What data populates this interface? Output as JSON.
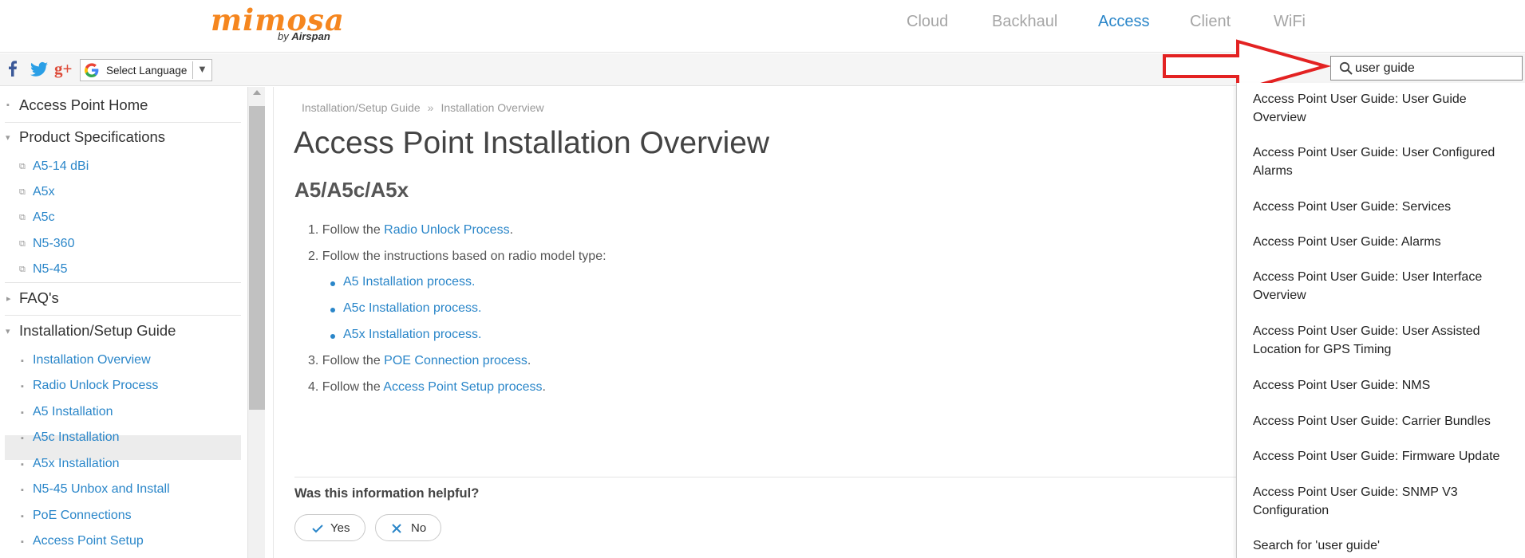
{
  "brand": {
    "name": "mimosa",
    "byline_prefix": "by",
    "byline_company": "Airspan",
    "accent": "#f5861f"
  },
  "topnav": {
    "items": [
      {
        "label": "Cloud",
        "active": false
      },
      {
        "label": "Backhaul",
        "active": false
      },
      {
        "label": "Access",
        "active": true
      },
      {
        "label": "Client",
        "active": false
      },
      {
        "label": "WiFi",
        "active": false
      }
    ],
    "active_color": "#2a86c9"
  },
  "toolbar": {
    "social_icons": [
      "facebook-icon",
      "twitter-icon",
      "google-plus-icon"
    ],
    "language": {
      "label": "Select Language",
      "icon": "google-icon",
      "arrow": "▼"
    }
  },
  "search": {
    "value": "user guide",
    "icon": "search-icon"
  },
  "sidebar": {
    "sections": [
      {
        "label": "Access Point Home",
        "icon": "page-icon"
      },
      {
        "label": "Product Specifications",
        "icon": "expanded-triangle-icon",
        "items": [
          {
            "label": "A5-14 dBi",
            "icon": "external-link-icon"
          },
          {
            "label": "A5x",
            "icon": "external-link-icon"
          },
          {
            "label": "A5c",
            "icon": "external-link-icon"
          },
          {
            "label": "N5-360",
            "icon": "external-link-icon"
          },
          {
            "label": "N5-45",
            "icon": "external-link-icon"
          }
        ]
      },
      {
        "label": "FAQ's",
        "icon": "collapsed-triangle-icon"
      },
      {
        "label": "Installation/Setup Guide",
        "icon": "expanded-triangle-icon",
        "items": [
          {
            "label": "Installation Overview",
            "icon": "page-icon",
            "selected": true
          },
          {
            "label": "Radio Unlock Process",
            "icon": "page-icon"
          },
          {
            "label": "A5 Installation",
            "icon": "page-icon"
          },
          {
            "label": "A5c Installation",
            "icon": "page-icon"
          },
          {
            "label": "A5x Installation",
            "icon": "page-icon"
          },
          {
            "label": "N5-45 Unbox and Install",
            "icon": "page-icon"
          },
          {
            "label": "PoE Connections",
            "icon": "page-icon"
          },
          {
            "label": "Access Point Setup",
            "icon": "page-icon"
          }
        ]
      }
    ]
  },
  "breadcrumb": {
    "items": [
      "Installation/Setup Guide",
      "Installation Overview"
    ],
    "separator": "»"
  },
  "page": {
    "title": "Access Point Installation Overview",
    "section_title": "A5/A5c/A5x",
    "steps": [
      {
        "num": "1.",
        "prefix": "Follow the ",
        "link": "Radio Unlock Process",
        "suffix": "."
      },
      {
        "num": "2.",
        "prefix": "Follow the instructions based on radio model type:",
        "link": "",
        "suffix": ""
      },
      {
        "num": "3.",
        "prefix": "Follow the ",
        "link": "POE Connection process",
        "suffix": "."
      },
      {
        "num": "4.",
        "prefix": "Follow the ",
        "link": "Access Point Setup process",
        "suffix": "."
      }
    ],
    "substeps": [
      "A5 Installation process.",
      "A5c Installation process.",
      "A5x Installation process."
    ]
  },
  "feedback": {
    "question": "Was this information helpful?",
    "yes_label": "Yes",
    "no_label": "No"
  },
  "suggestions": [
    "Access Point User Guide: User Guide Overview",
    "Access Point User Guide: User Configured Alarms",
    "Access Point User Guide: Services",
    "Access Point User Guide: Alarms",
    "Access Point User Guide: User Interface Overview",
    "Access Point User Guide: User Assisted Location for GPS Timing",
    "Access Point User Guide: NMS",
    "Access Point User Guide: Carrier Bundles",
    "Access Point User Guide: Firmware Update",
    "Access Point User Guide: SNMP V3 Configuration",
    "Search for 'user guide'"
  ],
  "annotation": {
    "arrow_color": "#e32222"
  },
  "link_color": "#2a86c9"
}
